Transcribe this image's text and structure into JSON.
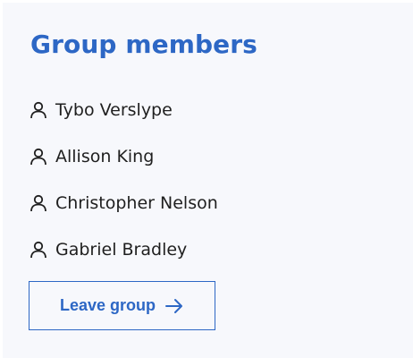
{
  "group": {
    "title": "Group members",
    "members": [
      {
        "name": "Tybo Verslype",
        "icon": "user-icon"
      },
      {
        "name": "Allison King",
        "icon": "user-icon"
      },
      {
        "name": "Christopher Nelson",
        "icon": "user-icon"
      },
      {
        "name": "Gabriel Bradley",
        "icon": "user-icon"
      }
    ],
    "leave_button": {
      "label": "Leave group",
      "icon": "arrow-right-icon"
    }
  },
  "colors": {
    "accent": "#2d67c5",
    "card_background": "#f7f8fc",
    "text": "#1f1f1f"
  }
}
